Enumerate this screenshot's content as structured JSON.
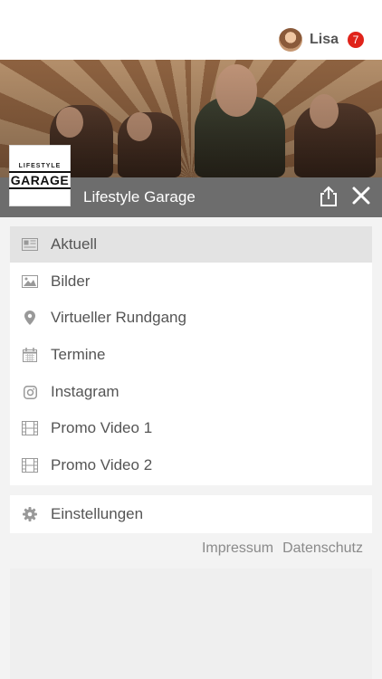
{
  "user": {
    "name": "Lisa",
    "badge_count": "7"
  },
  "venue": {
    "title": "Lifestyle Garage",
    "logo_top": "LIFESTYLE",
    "logo_main": "GARAGE"
  },
  "menu": {
    "items": [
      {
        "label": "Aktuell",
        "icon": "newspaper-icon",
        "active": true
      },
      {
        "label": "Bilder",
        "icon": "image-icon"
      },
      {
        "label": "Virtueller Rundgang",
        "icon": "location-pin-icon"
      },
      {
        "label": "Termine",
        "icon": "calendar-icon"
      },
      {
        "label": "Instagram",
        "icon": "instagram-icon"
      },
      {
        "label": "Promo Video 1",
        "icon": "film-icon"
      },
      {
        "label": "Promo Video 2",
        "icon": "film-icon"
      }
    ]
  },
  "settings": {
    "label": "Einstellungen",
    "icon": "gear-icon"
  },
  "footer": {
    "impressum": "Impressum",
    "datenschutz": "Datenschutz"
  },
  "colors": {
    "namebar": "#6d6d6d",
    "badge": "#e0231a",
    "active_row": "#e3e3e3"
  }
}
